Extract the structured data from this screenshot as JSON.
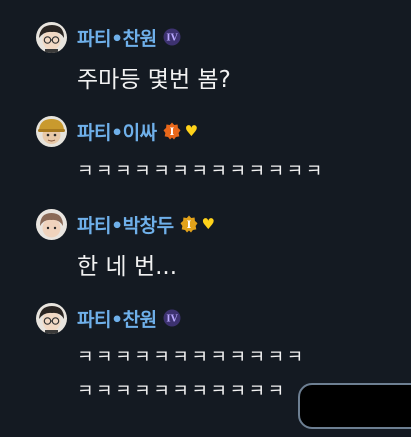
{
  "messages": [
    {
      "username": "파티•찬원",
      "avatar": "avatar-dark-hair-glasses",
      "badges": [
        "roman-four-badge"
      ],
      "lines": [
        "주마등 몇번 봄?"
      ]
    },
    {
      "username": "파티•이싸",
      "avatar": "avatar-hardhat",
      "badges": [
        "orange-i-badge",
        "heart-icon"
      ],
      "lines": [
        "ㅋㅋㅋㅋㅋㅋㅋㅋㅋㅋㅋㅋㅋ"
      ]
    },
    {
      "username": "파티•박창두",
      "avatar": "avatar-brown-hair",
      "badges": [
        "gold-i-badge",
        "heart-icon"
      ],
      "lines": [
        "한 네 번..."
      ]
    },
    {
      "username": "파티•찬원",
      "avatar": "avatar-dark-hair-glasses",
      "badges": [
        "roman-four-badge"
      ],
      "lines": [
        "ㅋㅋㅋㅋㅋㅋㅋㅋㅋㅋㅋㅋ",
        "ㅋㅋㅋㅋㅋㅋㅋㅋㅋㅋㅋ"
      ]
    }
  ],
  "badge_text": {
    "roman_four": "IV",
    "orange_i": "I",
    "gold_i": "I",
    "heart": "♥"
  },
  "colors": {
    "background": "#141a22",
    "username": "#6fb0ea",
    "message_text": "#f2f2f2",
    "heart": "#ffd21a",
    "input_border": "#6d7f92"
  }
}
